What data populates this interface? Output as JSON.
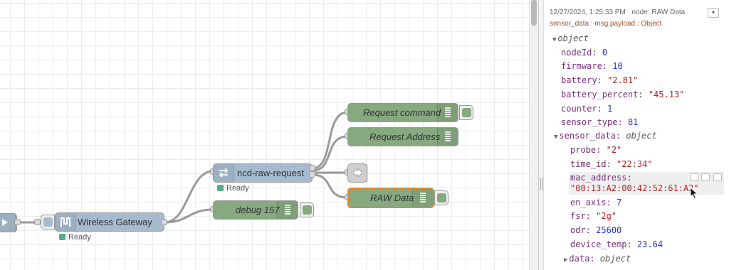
{
  "canvas": {
    "nodes": {
      "gateway": {
        "label": "Wireless Gateway",
        "status": "Ready"
      },
      "ncd_raw_request": {
        "label": "ncd-raw-request",
        "status": "Ready"
      },
      "request_command": {
        "label": "Request command"
      },
      "request_address": {
        "label": "Request Address"
      },
      "raw_data": {
        "label": "RAW Data"
      },
      "debug157": {
        "label": "debug 157"
      }
    },
    "colors": {
      "function_node": "#87a980",
      "network_node": "#a6bbcf",
      "selection": "#ff7f0e",
      "status_ok": "#5aa880"
    }
  },
  "debug_panel": {
    "timestamp": "12/27/2024, 1:25:33 PM",
    "node_label": "node: RAW Data",
    "topic": "sensor_data : msg.payload : Object",
    "tree": {
      "root_type": "object",
      "nodeId": {
        "key": "nodeId:",
        "value": "0"
      },
      "firmware": {
        "key": "firmware:",
        "value": "10"
      },
      "battery": {
        "key": "battery:",
        "value": "\"2.81\""
      },
      "battery_percent": {
        "key": "battery_percent:",
        "value": "\"45.13\""
      },
      "counter": {
        "key": "counter:",
        "value": "1"
      },
      "sensor_type": {
        "key": "sensor_type:",
        "value": "81"
      },
      "sensor_data": {
        "key": "sensor_data:",
        "type": "object"
      },
      "probe": {
        "key": "probe:",
        "value": "\"2\""
      },
      "time_id": {
        "key": "time_id:",
        "value": "\"22:34\""
      },
      "mac_address": {
        "key": "mac_address:",
        "value": "\"00:13:A2:00:42:52:61:A2\""
      },
      "en_axis": {
        "key": "en_axis:",
        "value": "7"
      },
      "fsr": {
        "key": "fsr:",
        "value": "\"2g\""
      },
      "odr": {
        "key": "odr:",
        "value": "25600"
      },
      "device_temp": {
        "key": "device_temp:",
        "value": "23.64"
      },
      "data": {
        "key": "data:",
        "type": "object"
      }
    }
  }
}
